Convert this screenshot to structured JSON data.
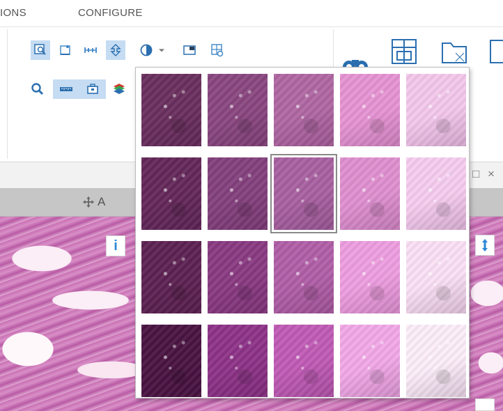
{
  "tabs": [
    {
      "label": "IONS"
    },
    {
      "label": "CONFIGURE"
    }
  ],
  "viewer": {
    "panel_label": "A",
    "info_label": "i",
    "maximize_glyph": "□",
    "close_glyph": "×"
  },
  "toolbar_icons": {
    "row1": [
      "zoom-region-icon",
      "annotate-icon",
      "measure-icon",
      "tree-icon",
      "contrast-icon",
      "dropdown-arrow-icon",
      "window-icon",
      "export-icon"
    ],
    "row2": [
      "magnifier-icon",
      "ruler-icon",
      "toolbox-icon",
      "layers-icon"
    ],
    "large": [
      "binoculars-icon",
      "grid-layout-icon",
      "folder-icon",
      "document-icon"
    ]
  },
  "color_adjust_popup": {
    "rows": 4,
    "cols": 5,
    "selected": {
      "row": 1,
      "col": 2
    },
    "swatch_colors": [
      [
        "#6a2f5e",
        "#8a4780",
        "#b067a3",
        "#e694d3",
        "#f4c8ec"
      ],
      [
        "#64285a",
        "#84407d",
        "#a861a1",
        "#df90d0",
        "#f6cdef"
      ],
      [
        "#5d2252",
        "#8a3a82",
        "#b15fa8",
        "#ee9ee0",
        "#fbe0f5"
      ],
      [
        "#4a1442",
        "#8e3388",
        "#c05bb6",
        "#f2a9e8",
        "#fdeefa"
      ]
    ]
  },
  "colors": {
    "selected_tool_bg": "#c5dcf3",
    "accent_blue": "#2b87d6"
  }
}
